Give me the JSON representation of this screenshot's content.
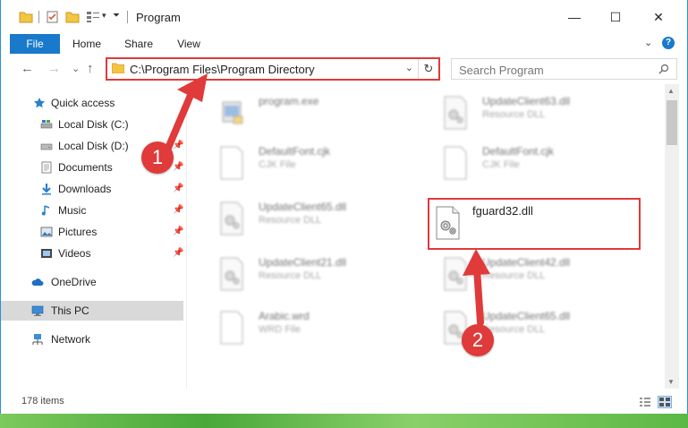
{
  "window": {
    "title": "Program",
    "minimize_glyph": "—",
    "maximize_glyph": "☐",
    "close_glyph": "✕"
  },
  "ribbon": {
    "tabs": [
      "File",
      "Home",
      "Share",
      "View"
    ],
    "expand_glyph": "⌄",
    "help_glyph": "?"
  },
  "nav": {
    "back_glyph": "←",
    "forward_glyph": "→",
    "dropdown_glyph": "⌄",
    "up_glyph": "↑",
    "address": "C:\\Program Files\\Program Directory",
    "address_dropdown_glyph": "⌄",
    "refresh_glyph": "↻",
    "search_placeholder": "Search Program"
  },
  "sidebar": {
    "items": [
      {
        "label": "Quick access",
        "icon": "star-icon"
      },
      {
        "label": "Local Disk (C:)",
        "icon": "drive-icon"
      },
      {
        "label": "Local Disk (D:)",
        "icon": "drive-icon"
      },
      {
        "label": "Documents",
        "icon": "documents-icon"
      },
      {
        "label": "Downloads",
        "icon": "downloads-icon"
      },
      {
        "label": "Music",
        "icon": "music-icon"
      },
      {
        "label": "Pictures",
        "icon": "pictures-icon"
      },
      {
        "label": "Videos",
        "icon": "videos-icon"
      },
      {
        "label": "OneDrive",
        "icon": "cloud-icon"
      },
      {
        "label": "This PC",
        "icon": "computer-icon"
      },
      {
        "label": "Network",
        "icon": "network-icon"
      }
    ],
    "pin_glyph": "📌"
  },
  "files": [
    {
      "name": "program.exe",
      "type": ""
    },
    {
      "name": "UpdateClient63.dll",
      "type": "Resource DLL"
    },
    {
      "name": "DefaultFont.cjk",
      "type": "CJK File"
    },
    {
      "name": "DefaultFont.cjk",
      "type": "CJK File"
    },
    {
      "name": "UpdateClient65.dll",
      "type": "Resource DLL"
    },
    {
      "name": "fguard32.dll",
      "type": ""
    },
    {
      "name": "UpdateClient21.dll",
      "type": "Resource DLL"
    },
    {
      "name": "UpdateClient42.dll",
      "type": "Resource DLL"
    },
    {
      "name": "Arabic.wrd",
      "type": "WRD File"
    },
    {
      "name": "UpdateClient65.dll",
      "type": "Resource DLL"
    }
  ],
  "status": {
    "item_count": "178 items"
  },
  "annotations": {
    "step1": "1",
    "step2": "2"
  },
  "colors": {
    "accent_blue": "#1979ca",
    "highlight_red": "#e03a3a",
    "selected_gray": "#d9d9d9"
  }
}
